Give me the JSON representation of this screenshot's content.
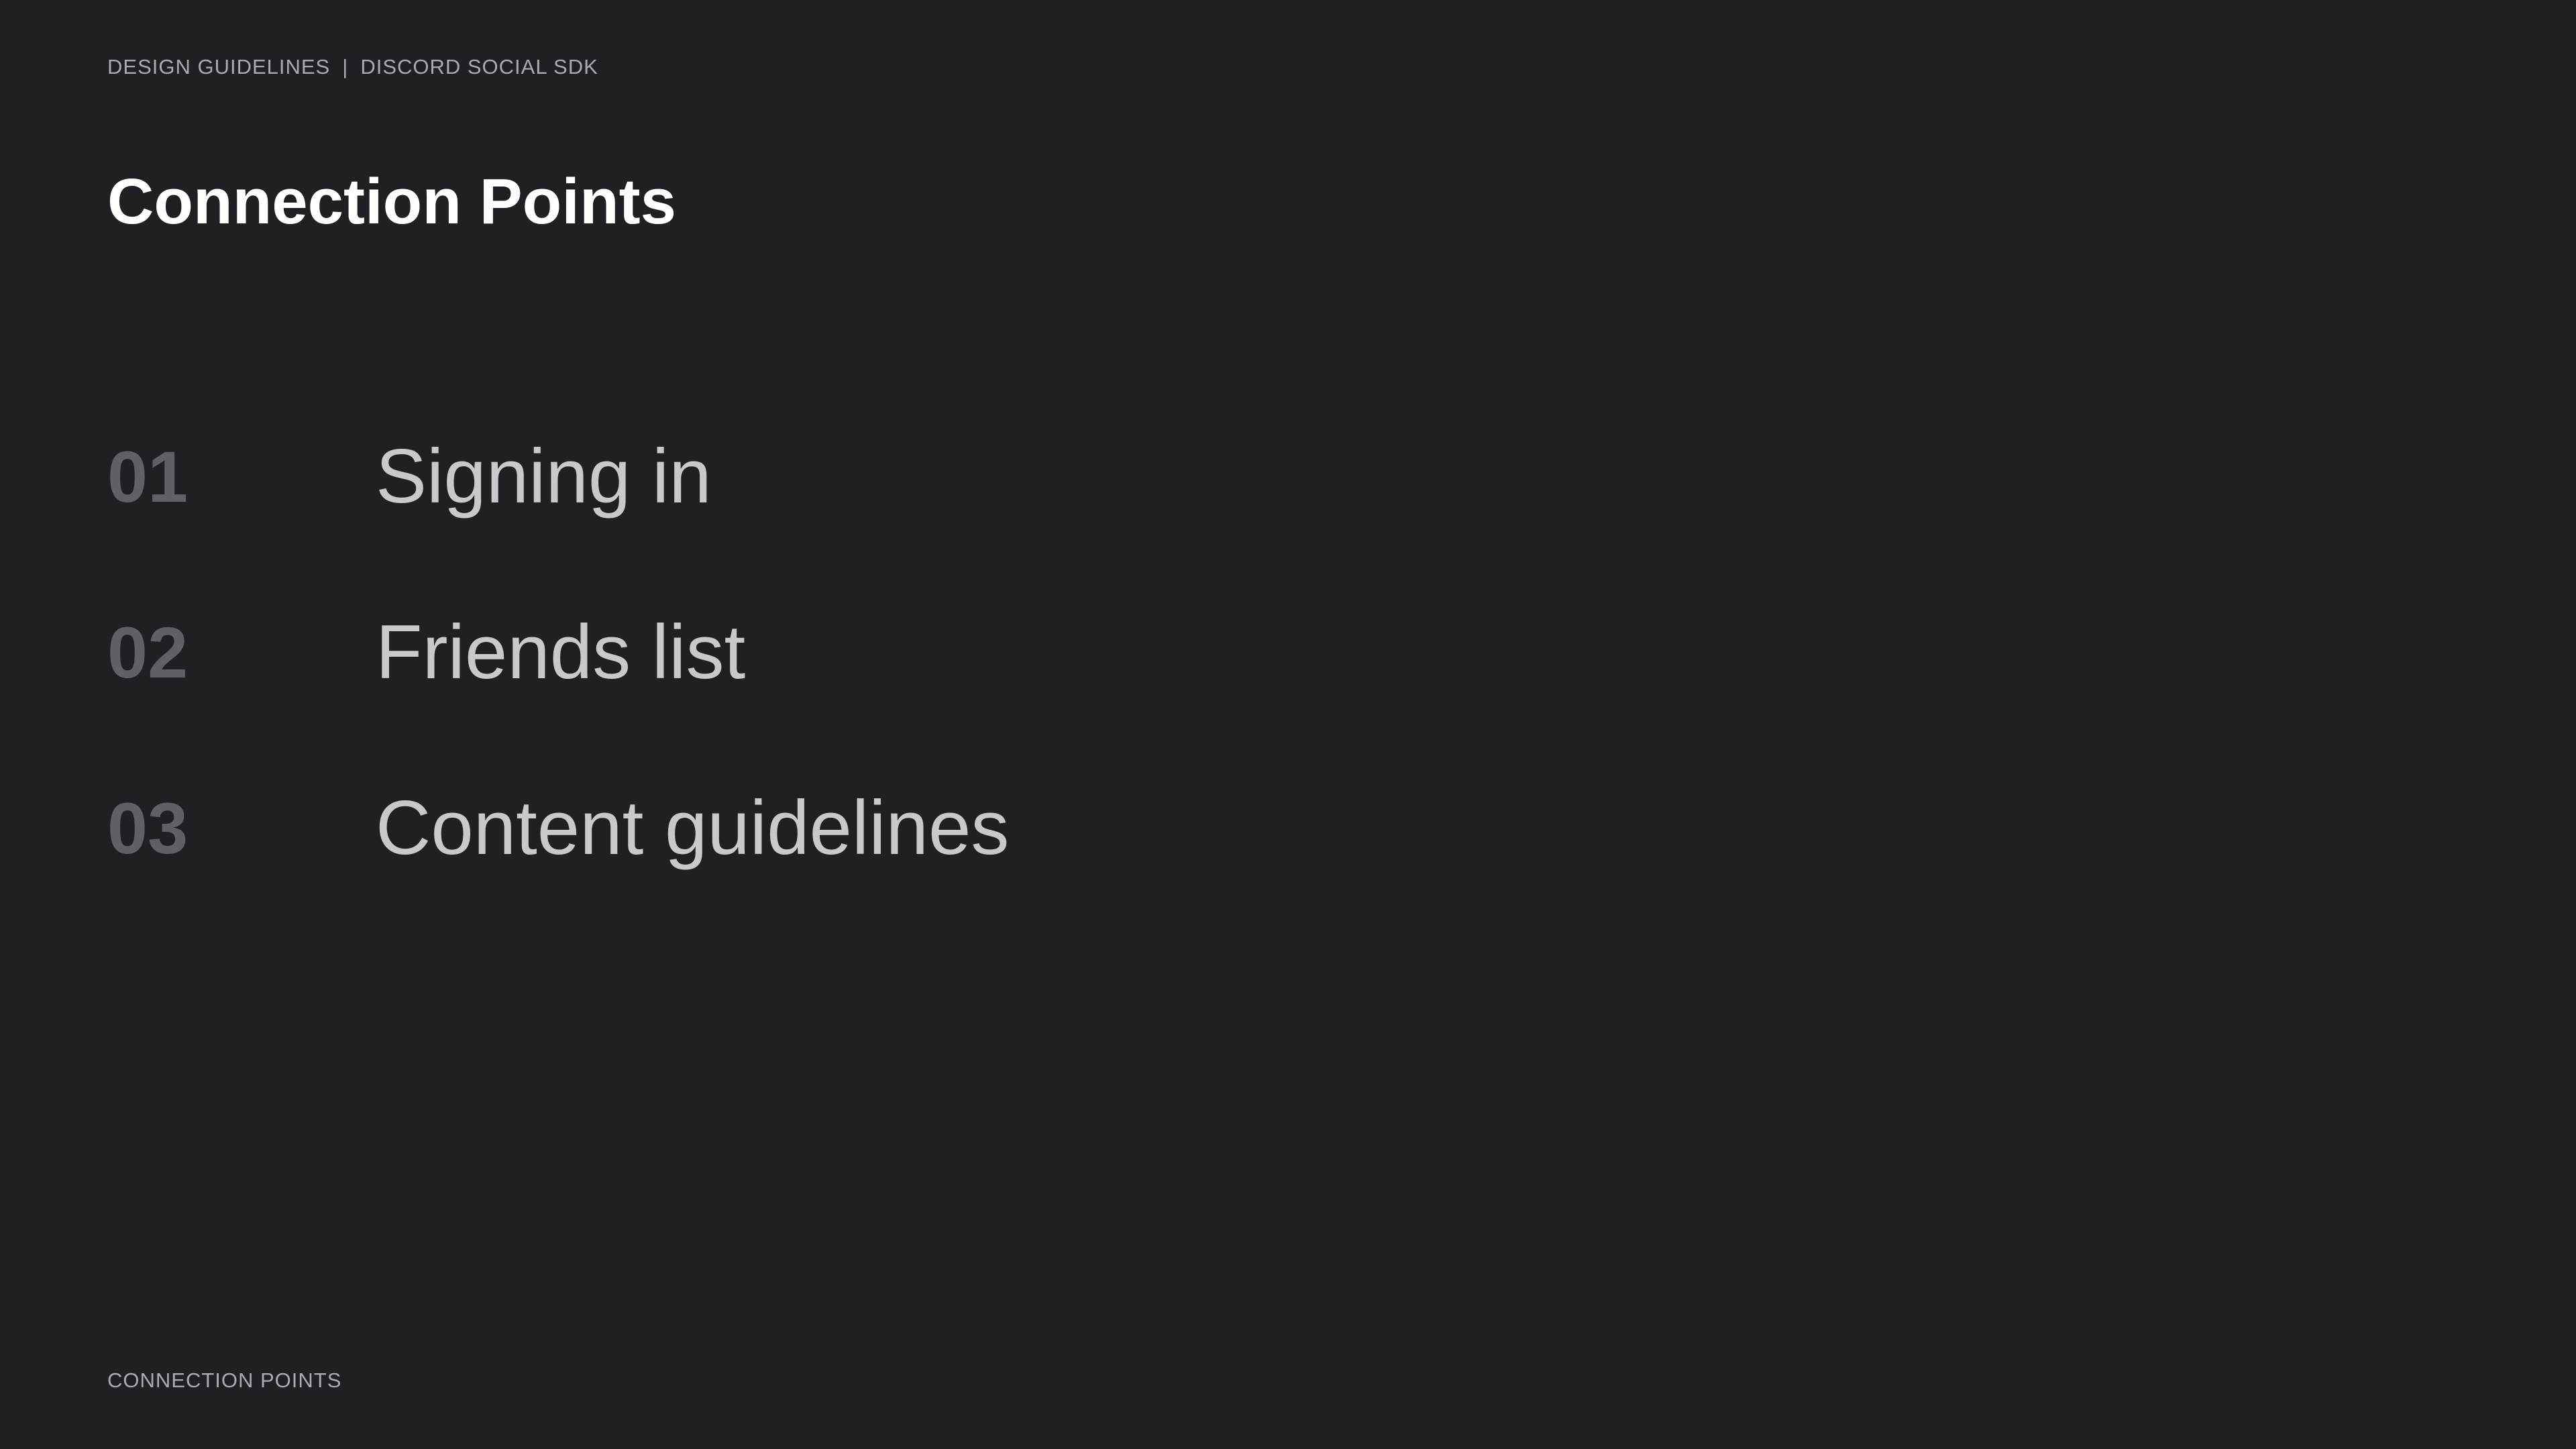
{
  "header": {
    "breadcrumb_primary": "DESIGN GUIDELINES",
    "breadcrumb_separator": "|",
    "breadcrumb_secondary": "DISCORD SOCIAL SDK"
  },
  "main": {
    "title": "Connection Points",
    "items": [
      {
        "number": "01",
        "label": "Signing in"
      },
      {
        "number": "02",
        "label": "Friends list"
      },
      {
        "number": "03",
        "label": "Content guidelines"
      }
    ]
  },
  "footer": {
    "label": "CONNECTION POINTS"
  },
  "colors": {
    "background": "#1f2024",
    "title": "#ffffff",
    "number": "#606166",
    "label": "#c8c9cd",
    "meta": "#a9abb1"
  }
}
